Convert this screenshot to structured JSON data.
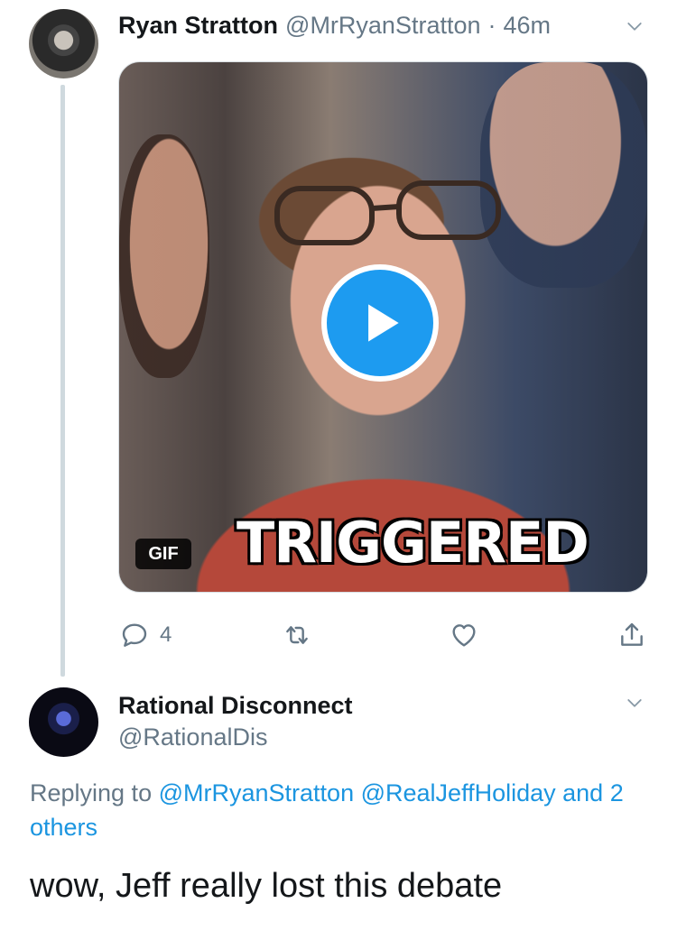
{
  "tweet1": {
    "name": "Ryan Stratton",
    "handle": "@MrRyanStratton",
    "separator": "·",
    "time": "46m",
    "media": {
      "type_badge": "GIF",
      "caption": "TRIGGERED"
    },
    "reply_count": "4"
  },
  "tweet2": {
    "name": "Rational Disconnect",
    "handle": "@RationalDis",
    "replying_prefix": "Replying to",
    "mentions": [
      "@MrRyanStratton",
      "@RealJeffHoliday"
    ],
    "and_text": "and",
    "others_text": "2 others",
    "text": "wow, Jeff really lost this debate"
  },
  "icons": {
    "chevron": "chevron-down-icon",
    "reply": "reply-icon",
    "retweet": "retweet-icon",
    "like": "heart-icon",
    "share": "share-icon",
    "play": "play-icon"
  },
  "colors": {
    "accent": "#1d9bf0",
    "link": "#1b95e0",
    "secondary_text": "#657786",
    "thread_line": "#cfd9de"
  }
}
